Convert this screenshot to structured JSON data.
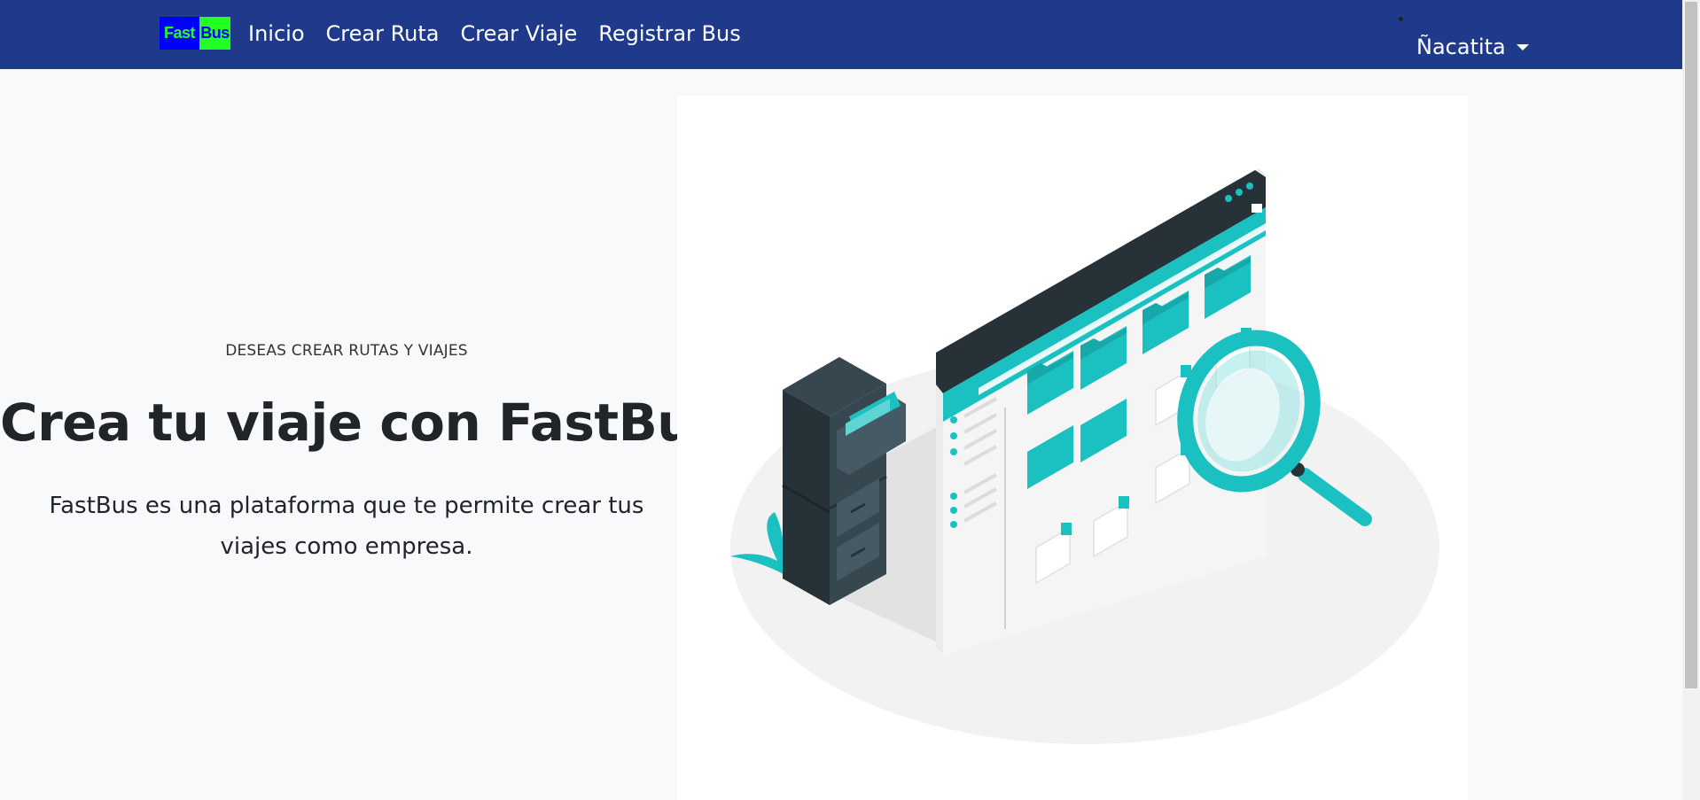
{
  "navbar": {
    "brand": {
      "part1": "Fast",
      "part2": "Bus"
    },
    "links": [
      "Inicio",
      "Crear Ruta",
      "Crear Viaje",
      "Registrar Bus"
    ],
    "user_label": "Ñacatita"
  },
  "hero": {
    "eyebrow": "DESEAS CREAR RUTAS Y VIAJES",
    "headline": "Crea tu viaje con FastBus",
    "lead": "FastBus es una plataforma que te permite crear tus viajes como empresa."
  },
  "colors": {
    "navbar_bg": "#1f3a8a",
    "accent": "#1bc1c1",
    "dark": "#263238"
  }
}
